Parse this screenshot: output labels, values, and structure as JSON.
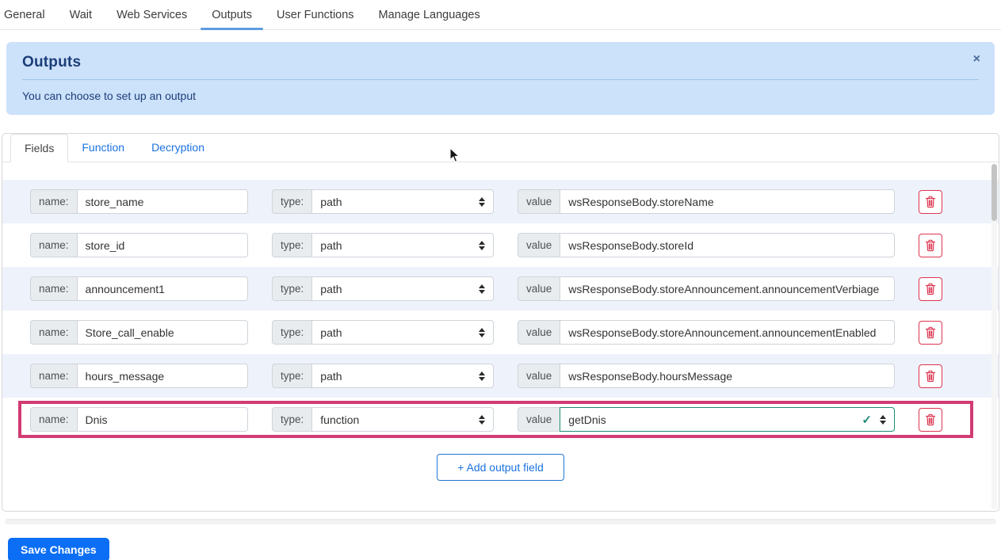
{
  "nav": {
    "tabs": [
      {
        "label": "General",
        "active": false
      },
      {
        "label": "Wait",
        "active": false
      },
      {
        "label": "Web Services",
        "active": false
      },
      {
        "label": "Outputs",
        "active": true
      },
      {
        "label": "User Functions",
        "active": false
      },
      {
        "label": "Manage Languages",
        "active": false
      }
    ]
  },
  "alert": {
    "title": "Outputs",
    "message": "You can choose to set up an output",
    "close_glyph": "×"
  },
  "panel": {
    "tabs": [
      {
        "label": "Fields",
        "active": true
      },
      {
        "label": "Function",
        "active": false
      },
      {
        "label": "Decryption",
        "active": false
      }
    ],
    "field_labels": {
      "name": "name:",
      "type": "type:",
      "value": "value"
    },
    "rows": [
      {
        "name": "store_name",
        "type": "path",
        "value": "wsResponseBody.storeName",
        "value_control": "input",
        "valid": false,
        "highlighted": false
      },
      {
        "name": "store_id",
        "type": "path",
        "value": "wsResponseBody.storeId",
        "value_control": "input",
        "valid": false,
        "highlighted": false
      },
      {
        "name": "announcement1",
        "type": "path",
        "value": "wsResponseBody.storeAnnouncement.announcementVerbiage",
        "value_control": "input",
        "valid": false,
        "highlighted": false
      },
      {
        "name": "Store_call_enable",
        "type": "path",
        "value": "wsResponseBody.storeAnnouncement.announcementEnabled",
        "value_control": "input",
        "valid": false,
        "highlighted": false
      },
      {
        "name": "hours_message",
        "type": "path",
        "value": "wsResponseBody.hoursMessage",
        "value_control": "input",
        "valid": false,
        "highlighted": false
      },
      {
        "name": "Dnis",
        "type": "function",
        "value": "getDnis",
        "value_control": "select",
        "valid": true,
        "highlighted": true
      }
    ],
    "add_button_label": "+ Add output field"
  },
  "footer": {
    "save_button_label": "Save Changes"
  },
  "icons": {
    "valid_check": "✓"
  },
  "colors": {
    "nav_active_underline": "#5e9ce0",
    "link_blue": "#1d73e0",
    "alert_bg": "#cce1fa",
    "alert_text": "#1c3e78",
    "row_alt_bg": "#eef2fb",
    "highlight_pink": "#d23b73",
    "valid_green": "#1d8a74",
    "danger_red": "#dc3550",
    "save_button_bg": "#0b6ef5"
  }
}
